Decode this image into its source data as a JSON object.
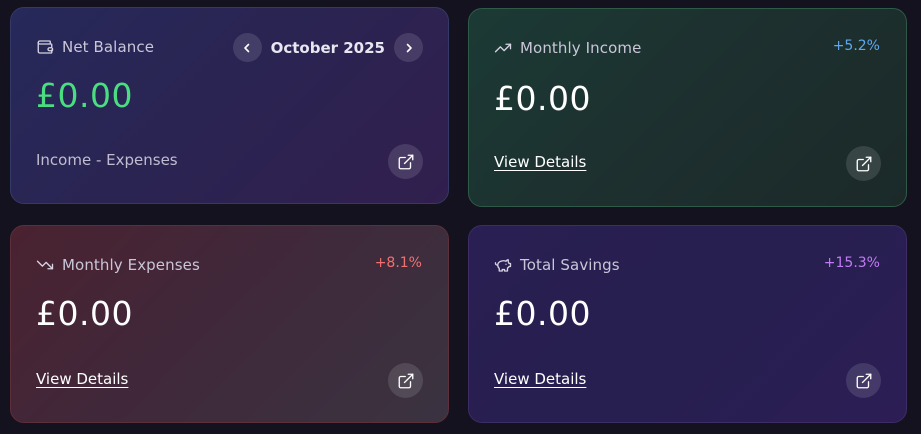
{
  "net_balance": {
    "label": "Net Balance",
    "month": "October 2025",
    "amount": "£0.00",
    "subtitle": "Income - Expenses",
    "amount_color": "#4ade80"
  },
  "monthly_income": {
    "label": "Monthly Income",
    "change": "+5.2%",
    "amount": "£0.00",
    "link": "View Details",
    "accent": "#5fa8f0"
  },
  "monthly_expenses": {
    "label": "Monthly Expenses",
    "change": "+8.1%",
    "amount": "£0.00",
    "link": "View Details",
    "accent": "#f07171"
  },
  "total_savings": {
    "label": "Total Savings",
    "change": "+15.3%",
    "amount": "£0.00",
    "link": "View Details",
    "accent": "#c07cf2"
  },
  "icons": {
    "net_balance": "wallet-icon",
    "monthly_income": "trending-up-icon",
    "monthly_expenses": "trending-down-icon",
    "total_savings": "piggy-bank-icon",
    "month_prev": "chevron-left-icon",
    "month_next": "chevron-right-icon",
    "open": "external-link-icon"
  }
}
